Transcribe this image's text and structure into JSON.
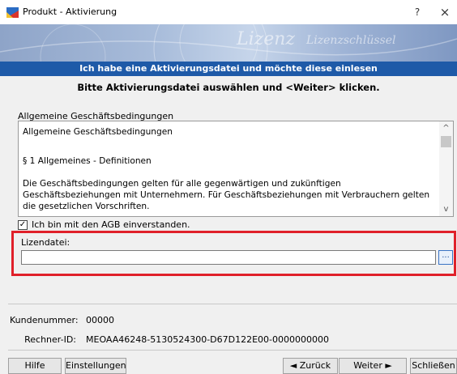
{
  "window": {
    "title": "Produkt - Aktivierung",
    "help_glyph": "?",
    "close_glyph": "×",
    "icon": "app-logo-icon"
  },
  "banner": {
    "watermark_1": "Lizenz",
    "watermark_2": "Lizenzschlüssel"
  },
  "heading": "Ich habe eine Aktivierungsdatei und möchte diese einlesen",
  "instruction": "Bitte Aktivierungsdatei auswählen und <Weiter> klicken.",
  "agb": {
    "label": "Allgemeine Geschäftsbedingungen",
    "lines": [
      "Allgemeine Geschäftsbedingungen",
      "§ 1 Allgemeines - Definitionen",
      "Die Geschäftsbedingungen gelten für alle gegenwärtigen und zukünftigen Geschäftsbeziehungen mit Unternehmern. Für Geschäftsbeziehungen mit Verbrauchern gelten die gesetzlichen Vorschriften."
    ],
    "scroll_up": "^",
    "scroll_down": "v"
  },
  "agree": {
    "checked": true,
    "check_glyph": "✓",
    "label": "Ich bin mit den AGB einverstanden."
  },
  "license": {
    "label": "Lizendatei:",
    "value": "",
    "browse_label": "..."
  },
  "info": {
    "customer_label": "Kundenummer:",
    "customer_value": "00000",
    "computer_label": "Rechner-ID:",
    "computer_value": "MEOAA46248-5130524300-D67D122E00-0000000000"
  },
  "buttons": {
    "help": "Hilfe",
    "settings": "Einstellungen",
    "back": "◄ Zurück",
    "next": "Weiter ►",
    "close": "Schließen"
  },
  "colors": {
    "heading_bar": "#1e5aa8",
    "highlight_frame": "#e0202a"
  }
}
